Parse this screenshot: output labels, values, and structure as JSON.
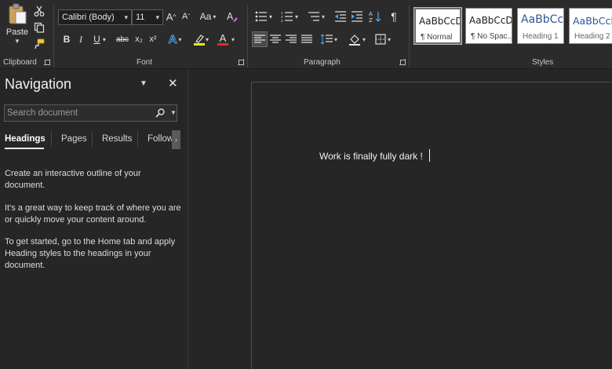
{
  "clipboard": {
    "paste_label": "Paste",
    "group_label": "Clipboard"
  },
  "font": {
    "name_value": "Calibri (Body)",
    "size_value": "11",
    "grow_icon": "A^",
    "shrink_icon": "Aˇ",
    "case_label": "Aa",
    "bold": "B",
    "italic": "I",
    "underline": "U",
    "strike": "abc",
    "subscript": "x₂",
    "superscript": "x²",
    "text_effects": "A",
    "font_color": "A",
    "highlight_color": "#f5e700",
    "font_color_bar": "#e52b2b",
    "group_label": "Font"
  },
  "paragraph": {
    "group_label": "Paragraph",
    "pilcrow": "¶"
  },
  "styles": {
    "group_label": "Styles",
    "items": [
      {
        "sample": "AaBbCcDc",
        "name": "¶ Normal"
      },
      {
        "sample": "AaBbCcDc",
        "name": "¶ No Spac..."
      },
      {
        "sample": "AaBbCc",
        "name": "Heading 1"
      },
      {
        "sample": "AaBbCcDc",
        "name": "Heading 2"
      }
    ]
  },
  "navigation": {
    "title": "Navigation",
    "search_placeholder": "Search document",
    "tabs": [
      "Headings",
      "Pages",
      "Results",
      "Follow"
    ],
    "paragraphs": [
      "Create an interactive outline of your document.",
      "It's a great way to keep track of where you are or quickly move your content around.",
      "To get started, go to the Home tab and apply Heading styles to the headings in your document."
    ]
  },
  "document": {
    "text": "Work is finally fully dark !"
  },
  "icons": {
    "cut": "scissors-icon",
    "copy": "copy-icon",
    "format_painter": "paintbrush-icon",
    "close": "close-icon",
    "search": "search-icon",
    "options": "chevron-down-icon"
  }
}
